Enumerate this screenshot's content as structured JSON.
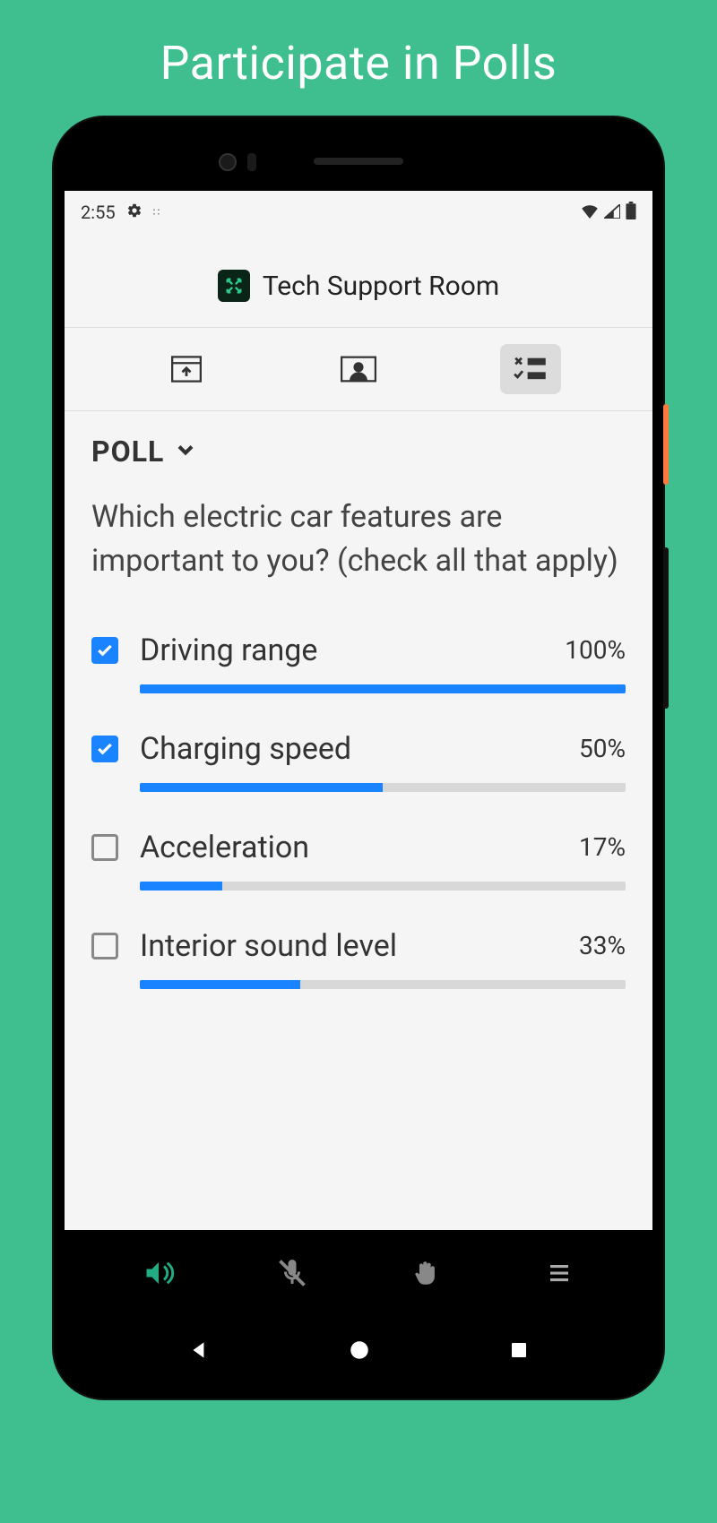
{
  "hero": {
    "title": "Participate in Polls"
  },
  "status": {
    "time": "2:55"
  },
  "room": {
    "title": "Tech Support Room"
  },
  "poll": {
    "label": "POLL",
    "question": "Which electric car features are important to you? (check all that apply)",
    "options": [
      {
        "label": "Driving range",
        "pct": "100%",
        "pct_num": 100,
        "checked": true
      },
      {
        "label": "Charging speed",
        "pct": "50%",
        "pct_num": 50,
        "checked": true
      },
      {
        "label": "Acceleration",
        "pct": "17%",
        "pct_num": 17,
        "checked": false
      },
      {
        "label": "Interior sound level",
        "pct": "33%",
        "pct_num": 33,
        "checked": false
      }
    ]
  },
  "colors": {
    "accent": "#1a83ff",
    "bg": "#3fbf8f"
  }
}
